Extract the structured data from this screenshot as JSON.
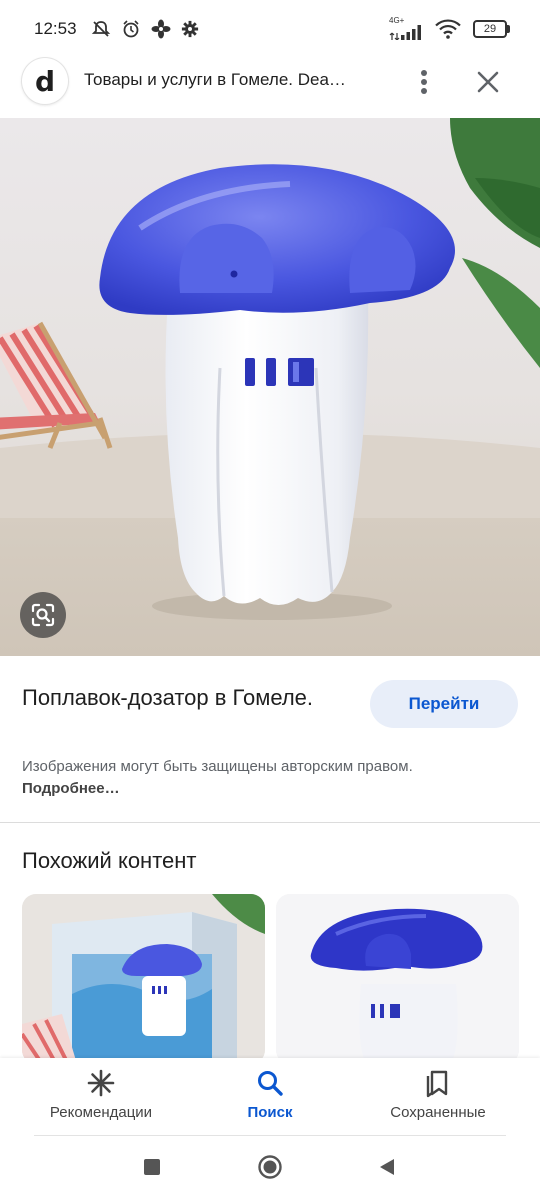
{
  "status_bar": {
    "time": "12:53",
    "network": "4G+",
    "battery": "29"
  },
  "header": {
    "site_letter": "d",
    "title": "Товары и услуги в Гомеле. Dea…"
  },
  "result": {
    "title": "Поплавок-дозатор в Гомеле.",
    "visit_label": "Перейти",
    "copyright_text": "Изображения могут быть защищены авторским правом. ",
    "copyright_more": "Подробнее…"
  },
  "similar": {
    "heading": "Похожий контент"
  },
  "bottom_nav": {
    "items": [
      {
        "label": "Рекомендации",
        "icon": "asterisk-icon"
      },
      {
        "label": "Поиск",
        "icon": "search-icon"
      },
      {
        "label": "Сохраненные",
        "icon": "bookmarks-icon"
      }
    ]
  },
  "colors": {
    "accent": "#0b57d0",
    "visit_button_bg": "#e8eef9",
    "mushroom_blue": "#4a57e0"
  }
}
